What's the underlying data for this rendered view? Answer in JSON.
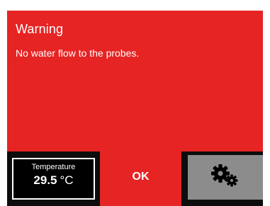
{
  "dialog": {
    "title": "Warning",
    "message": "No water flow to the probes.",
    "background_color": "#e62424"
  },
  "footer": {
    "temperature": {
      "label": "Temperature",
      "value": "29.5",
      "unit": "°C"
    },
    "ok_label": "OK",
    "settings_icon": "gears-icon"
  }
}
